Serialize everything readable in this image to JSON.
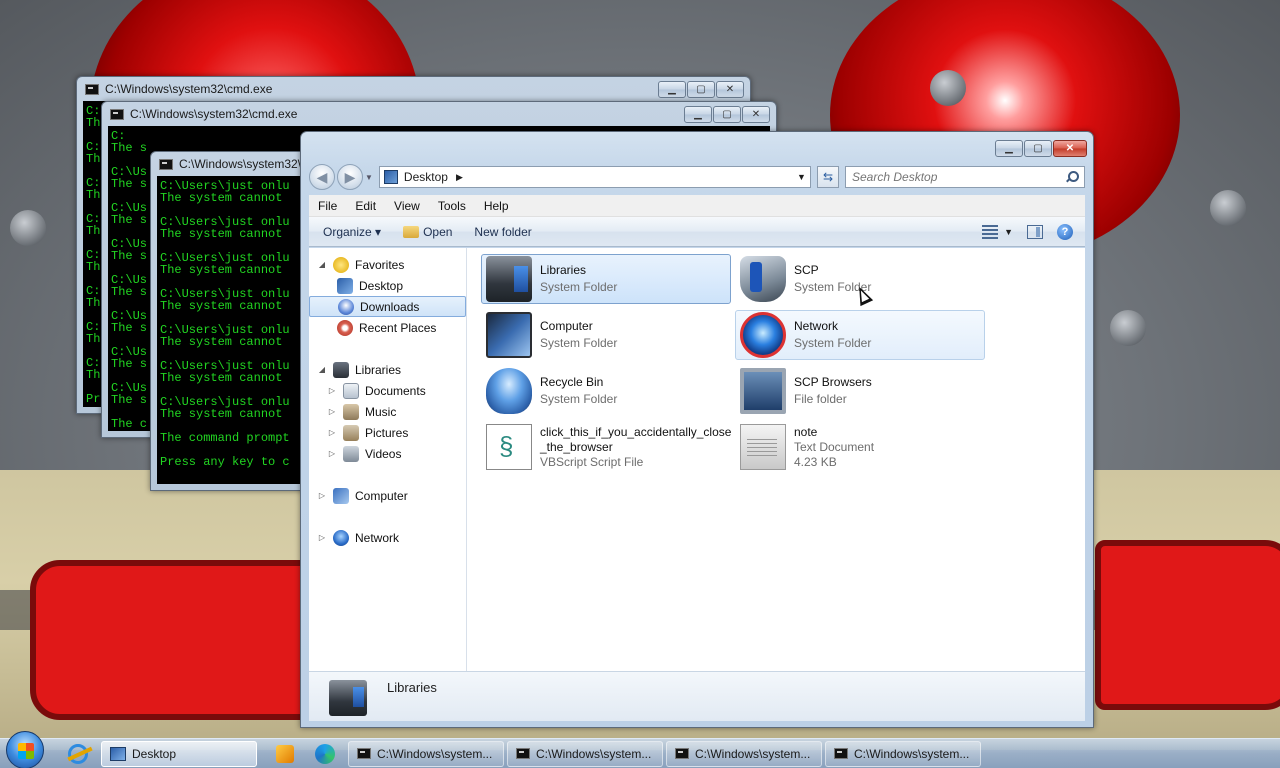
{
  "colors": {
    "cmd_text": "#22d522",
    "selection": "#cde3fa",
    "wallpaper_red": "#e01818"
  },
  "cmd_windows": [
    {
      "title": "C:\\Windows\\system32\\cmd.exe",
      "lines": [
        "C:",
        "The",
        "",
        "C:",
        "Th",
        "",
        "C:",
        "Th",
        "",
        "C:",
        "Th",
        "",
        "C:",
        "Th",
        "",
        "C:",
        "Th",
        "",
        "C:",
        "Th",
        "",
        "C:",
        "Th",
        "",
        "Pr"
      ]
    },
    {
      "title": "C:\\Windows\\system32\\cmd.exe",
      "lines": [
        "C:",
        "The s",
        "",
        "C:\\Us",
        "The s",
        "",
        "C:\\Us",
        "The s",
        "",
        "C:\\Us",
        "The s",
        "",
        "C:\\Us",
        "The s",
        "",
        "C:\\Us",
        "The s",
        "",
        "C:\\Us",
        "The s",
        "",
        "C:\\Us",
        "The s",
        "",
        "The c",
        "",
        "Press"
      ]
    },
    {
      "title": "C:\\Windows\\system32\\cmd.exe",
      "lines": [
        "C:\\Users\\just onlu",
        "The system cannot",
        "",
        "C:\\Users\\just onlu",
        "The system cannot",
        "",
        "C:\\Users\\just onlu",
        "The system cannot",
        "",
        "C:\\Users\\just onlu",
        "The system cannot",
        "",
        "C:\\Users\\just onlu",
        "The system cannot",
        "",
        "C:\\Users\\just onlu",
        "The system cannot",
        "",
        "C:\\Users\\just onlu",
        "The system cannot",
        "",
        "The command prompt",
        "",
        "Press any key to c"
      ]
    }
  ],
  "explorer": {
    "address": "Desktop",
    "search_placeholder": "Search Desktop",
    "menu": [
      "File",
      "Edit",
      "View",
      "Tools",
      "Help"
    ],
    "toolbar": {
      "organize": "Organize ▾",
      "open": "Open",
      "new_folder": "New folder"
    },
    "nav": {
      "favorites": "Favorites",
      "desktop": "Desktop",
      "downloads": "Downloads",
      "recent": "Recent Places",
      "libraries": "Libraries",
      "documents": "Documents",
      "music": "Music",
      "pictures": "Pictures",
      "videos": "Videos",
      "computer": "Computer",
      "network": "Network"
    },
    "files": [
      {
        "name": "Libraries",
        "sub": "System Folder",
        "sub2": ""
      },
      {
        "name": "SCP",
        "sub": "System Folder",
        "sub2": ""
      },
      {
        "name": "Computer",
        "sub": "System Folder",
        "sub2": ""
      },
      {
        "name": "Network",
        "sub": "System Folder",
        "sub2": ""
      },
      {
        "name": "Recycle Bin",
        "sub": "System Folder",
        "sub2": ""
      },
      {
        "name": "SCP Browsers",
        "sub": "File folder",
        "sub2": ""
      },
      {
        "name": "click_this_if_you_accidentally_close",
        "name2": "_the_browser",
        "sub": "VBScript Script File"
      },
      {
        "name": "note",
        "sub": "Text Document",
        "sub2": "4.23 KB"
      }
    ],
    "details_name": "Libraries"
  },
  "taskbar": {
    "desktop": "Desktop",
    "cmd": [
      "C:\\Windows\\system...",
      "C:\\Windows\\system...",
      "C:\\Windows\\system...",
      "C:\\Windows\\system..."
    ]
  }
}
